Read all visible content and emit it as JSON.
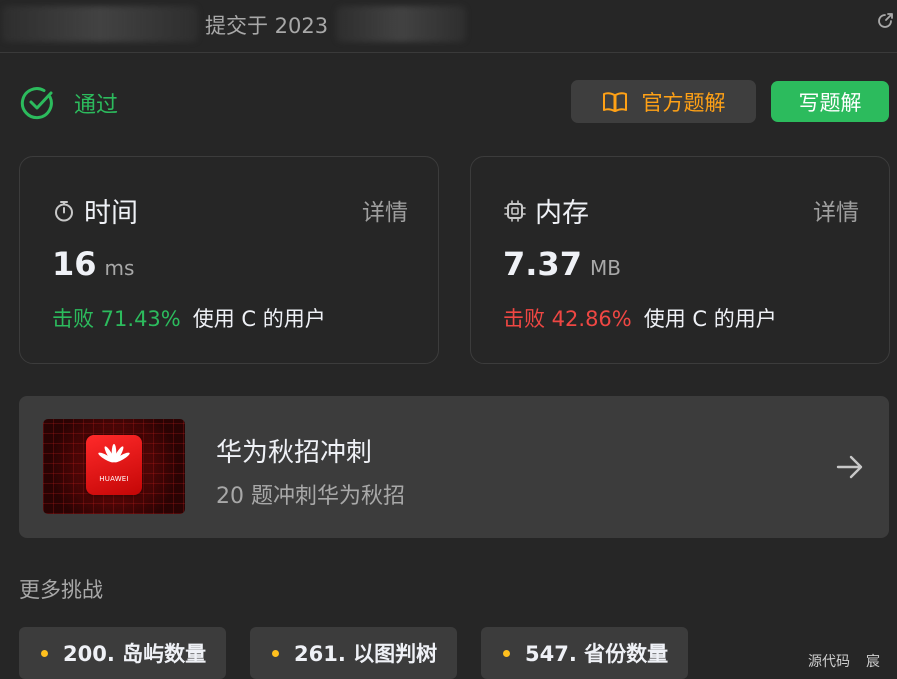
{
  "header": {
    "submitted_text": "提交于 2023",
    "external_icon": "external-link-icon"
  },
  "status": {
    "label": "通过",
    "icon": "check-circle-icon",
    "color": "#2cbb5d"
  },
  "actions": {
    "official_solution": "官方题解",
    "official_solution_icon": "book-icon",
    "write_solution": "写题解"
  },
  "runtime": {
    "icon": "stopwatch-icon",
    "title": "时间",
    "detail": "详情",
    "value": "16",
    "unit": "ms",
    "beat_pct": "击败 71.43%",
    "beat_rest": "使用 C 的用户"
  },
  "memory": {
    "icon": "chip-icon",
    "title": "内存",
    "detail": "详情",
    "value": "7.37",
    "unit": "MB",
    "beat_pct": "击败 42.86%",
    "beat_rest": "使用 C 的用户"
  },
  "promo": {
    "logo_text": "HUAWEI",
    "title": "华为秋招冲刺",
    "subtitle": "20 题冲刺华为秋招",
    "arrow_icon": "arrow-right-icon"
  },
  "more": {
    "title": "更多挑战",
    "items": [
      {
        "label": "200. 岛屿数量"
      },
      {
        "label": "261. 以图判树"
      },
      {
        "label": "547. 省份数量"
      }
    ]
  },
  "footer": {
    "links": [
      "源代码",
      "宸"
    ]
  },
  "colors": {
    "background": "#262626",
    "card": "#3c3c3c",
    "green": "#2cbb5d",
    "red": "#ef4743",
    "orange": "#ffa116",
    "yellow_dot": "#ffc01e"
  }
}
